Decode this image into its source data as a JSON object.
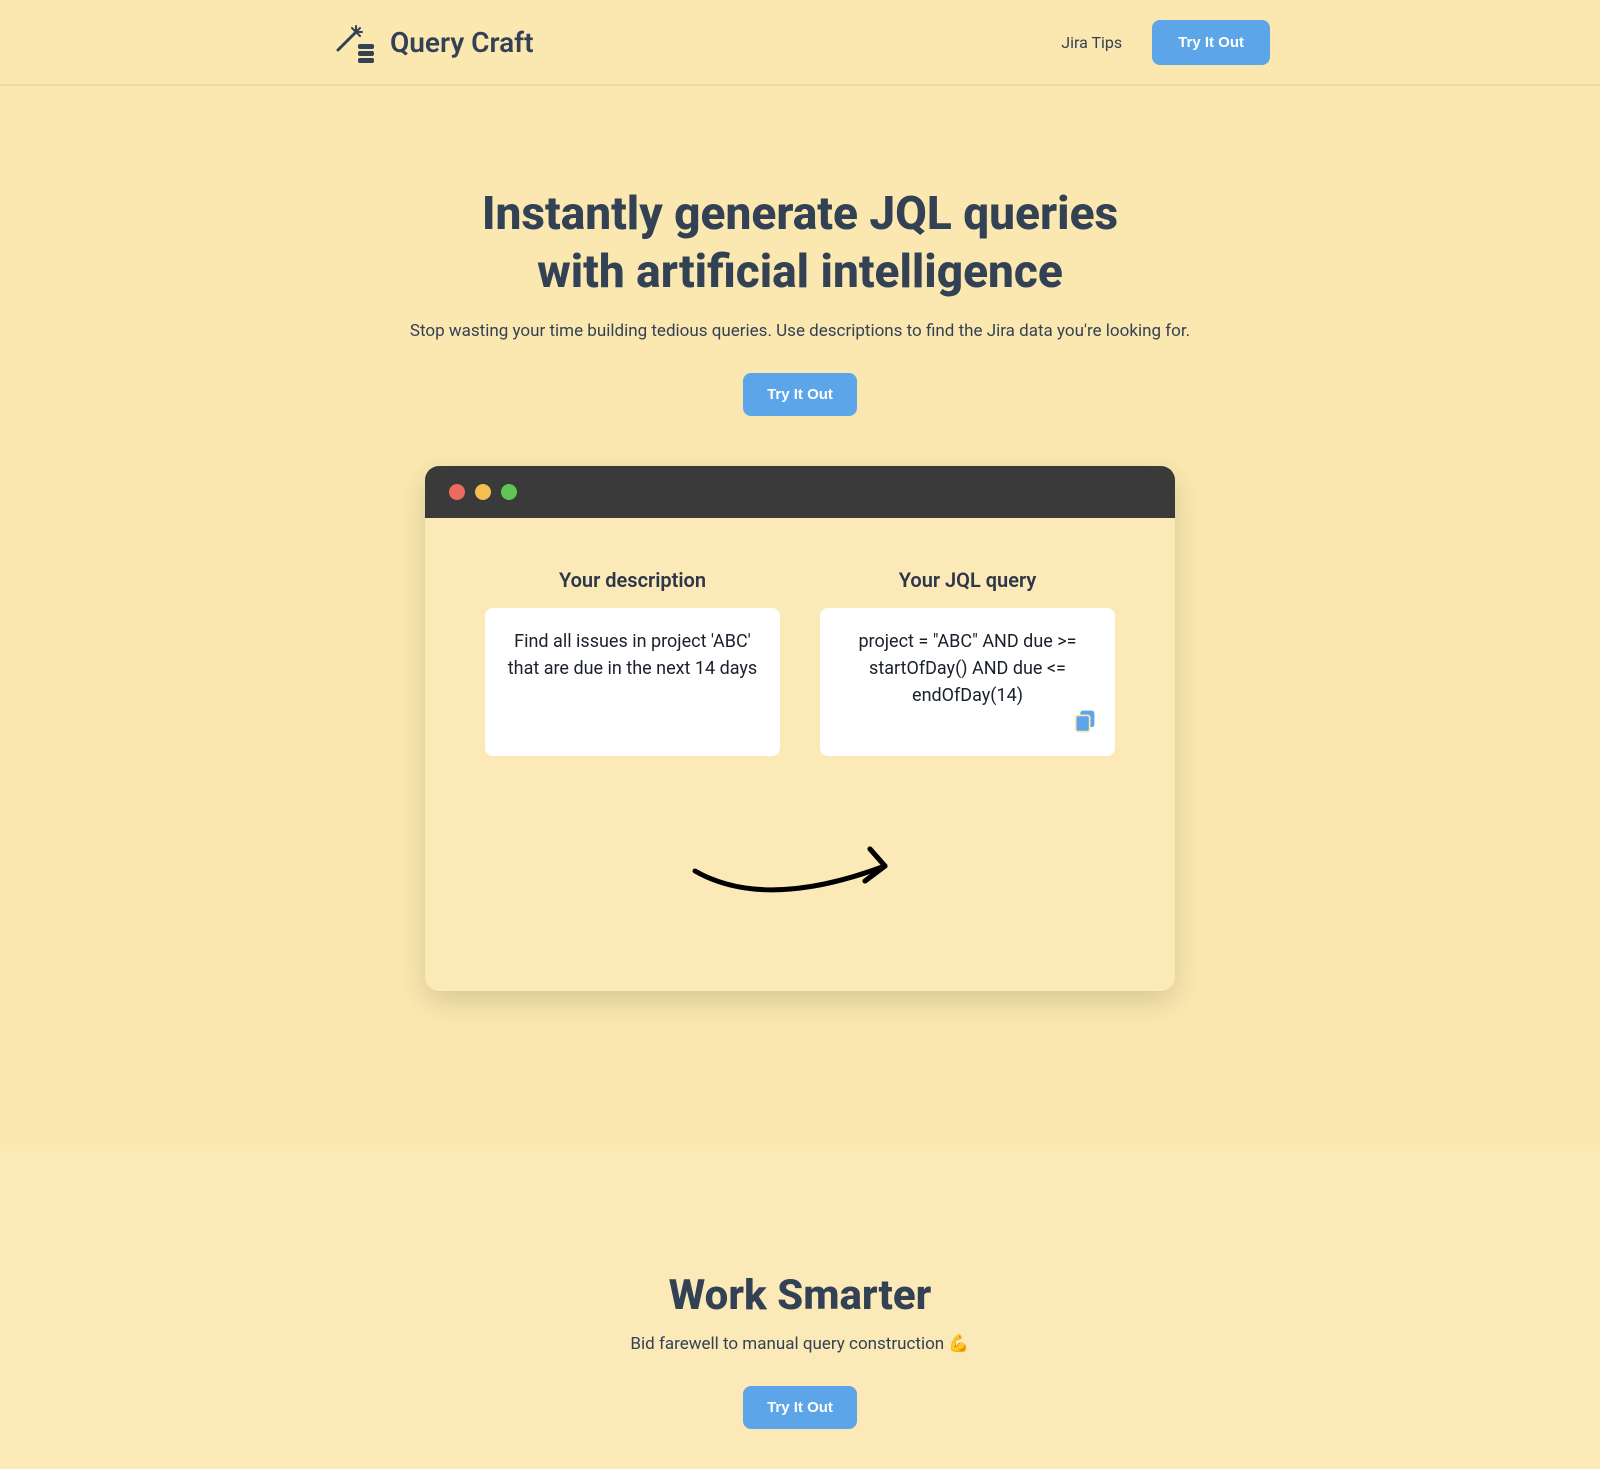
{
  "header": {
    "logo_text": "Query Craft",
    "nav_link": "Jira Tips",
    "cta_label": "Try It Out"
  },
  "hero": {
    "title": "Instantly generate JQL queries with artificial intelligence",
    "subtitle": "Stop wasting your time building tedious queries. Use descriptions to find the Jira data you're looking for.",
    "cta_label": "Try It Out"
  },
  "editor": {
    "left_label": "Your description",
    "left_content": "Find all issues in project 'ABC' that are due in the next 14 days",
    "right_label": "Your JQL query",
    "right_content": "project = \"ABC\" AND due >= startOfDay() AND due <= endOfDay(14)"
  },
  "section2": {
    "title": "Work Smarter",
    "subtitle": "Bid farewell to manual query construction 💪",
    "cta_label": "Try It Out"
  }
}
